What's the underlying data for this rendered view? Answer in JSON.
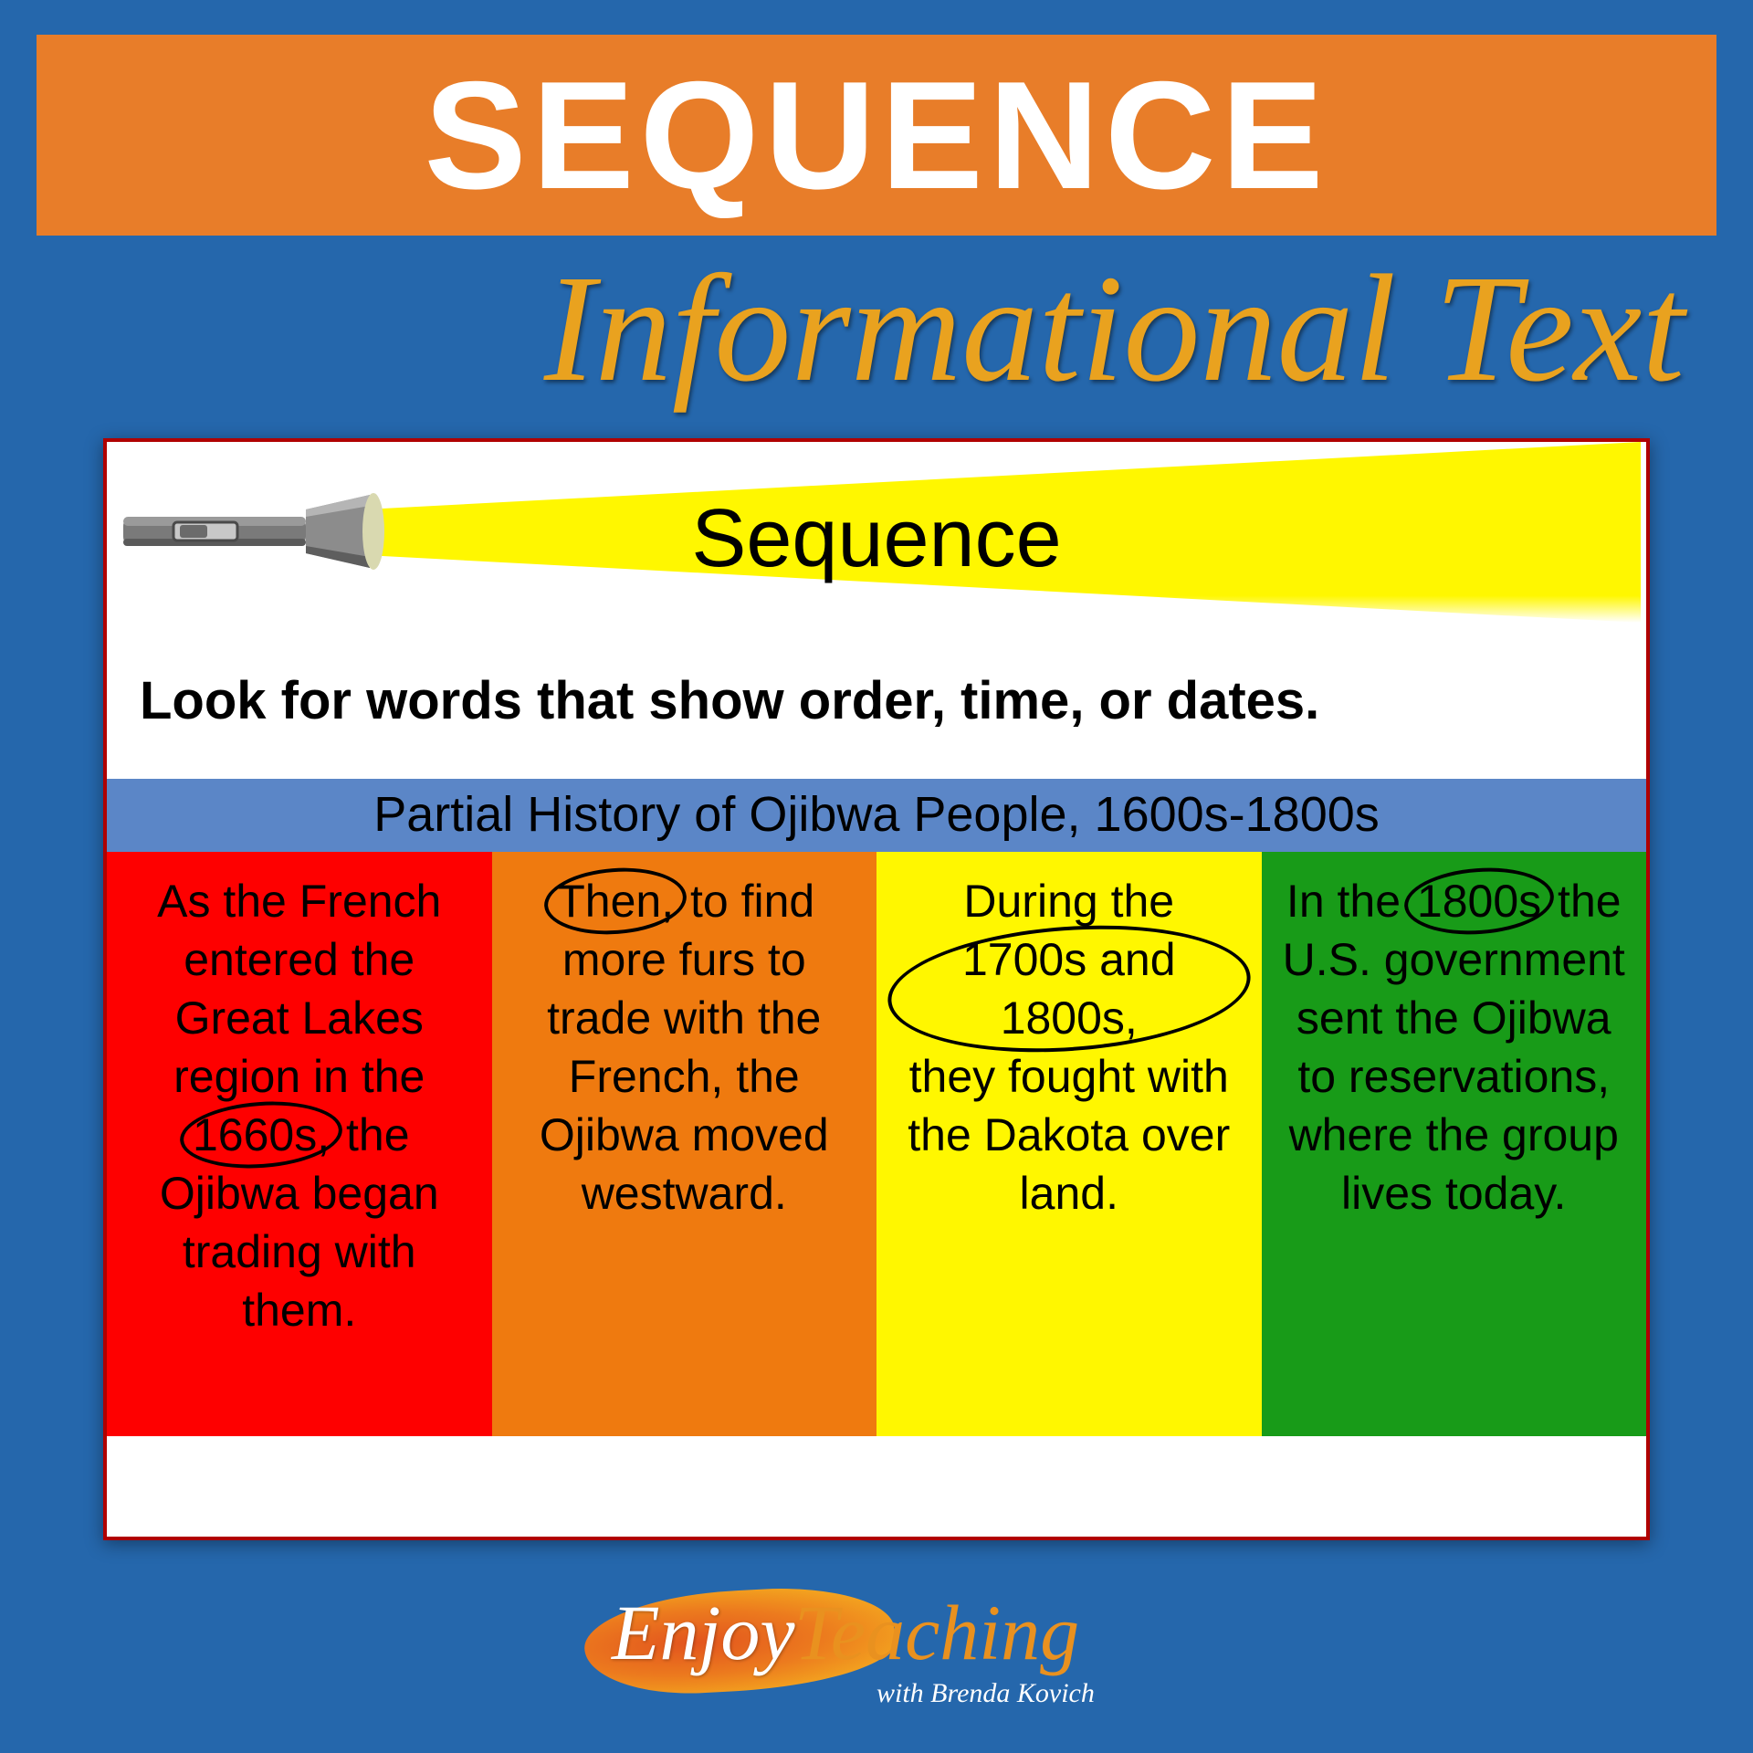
{
  "header": {
    "title": "SEQUENCE",
    "subtitle": "Informational Text"
  },
  "card": {
    "heading": "Sequence",
    "instruction": "Look for words that show order, time, or dates.",
    "subheader": "Partial History of Ojibwa People, 1600s-1800s",
    "columns": [
      {
        "color": "red",
        "pre": "As the French entered the Great Lakes region in the ",
        "key": "1660s,",
        "post": " the Ojibwa began trading with them."
      },
      {
        "color": "orange",
        "pre": "",
        "key": "Then,",
        "post": " to find more furs to trade with the French, the Ojibwa moved westward."
      },
      {
        "color": "yellow",
        "pre": "During the ",
        "key": "1700s and 1800s,",
        "post": " they fought with the Dakota over land."
      },
      {
        "color": "green",
        "pre": "In the ",
        "key": "1800s",
        "post": " the U.S. government sent the Ojibwa to reservations, where the group lives today."
      }
    ]
  },
  "logo": {
    "word1": "Enjoy",
    "word2": "Teaching",
    "byline": "with Brenda Kovich"
  }
}
